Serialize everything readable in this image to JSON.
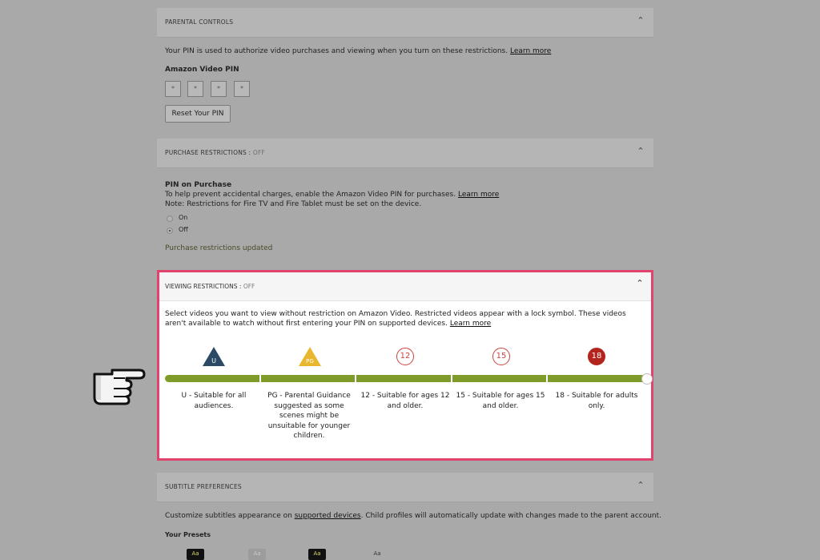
{
  "parental": {
    "header": "PARENTAL CONTROLS",
    "description": "Your PIN is used to authorize video purchases and viewing when you turn on these restrictions.",
    "learn_more": "Learn more",
    "pin_label": "Amazon Video PIN",
    "pin_digits": [
      "*",
      "*",
      "*",
      "*"
    ],
    "reset_button": "Reset Your PIN"
  },
  "purchase": {
    "header": "PURCHASE RESTRICTIONS : ",
    "status": "OFF",
    "title": "PIN on Purchase",
    "line1": "To help prevent accidental charges, enable the Amazon Video PIN for purchases.",
    "learn_more": "Learn more",
    "line2": "Note: Restrictions for Fire TV and Fire Tablet must be set on the device.",
    "option_on": "On",
    "option_off": "Off",
    "selected": "Off",
    "updated_msg": "Purchase restrictions updated"
  },
  "viewing": {
    "header": "VIEWING RESTRICTIONS : ",
    "status": "OFF",
    "description": "Select videos you want to view without restriction on Amazon Video. Restricted videos appear with a lock symbol. These videos aren't available to watch without first entering your PIN on supported devices.",
    "learn_more": "Learn more",
    "slider_value": 1.0,
    "ratings": [
      {
        "badge": "U",
        "label": "U - Suitable for all audiences.",
        "color": "#2c4a66"
      },
      {
        "badge": "PG",
        "label": "PG - Parental Guidance suggested as some scenes might be unsuitable for younger children.",
        "color": "#e9b72f"
      },
      {
        "badge": "12",
        "label": "12 - Suitable for ages 12 and older.",
        "color": "#d0413b"
      },
      {
        "badge": "15",
        "label": "15 - Suitable for ages 15 and older.",
        "color": "#d0413b"
      },
      {
        "badge": "18",
        "label": "18 - Suitable for adults only.",
        "color": "#b3241c"
      }
    ],
    "highlight_color": "#e0436e",
    "accent_color": "#7f9c2b"
  },
  "subtitles": {
    "header": "SUBTITLE PREFERENCES",
    "description_pre": "Customize subtitles appearance on",
    "link": "supported devices",
    "description_post": ". Child profiles will automatically update with changes made to the parent account.",
    "presets_label": "Your Presets",
    "presets": [
      "Aa",
      "Aa",
      "Aa",
      "Aa"
    ]
  },
  "icons": {
    "pointer": "pointing-hand-icon",
    "chevron": "chevron-up-icon"
  }
}
